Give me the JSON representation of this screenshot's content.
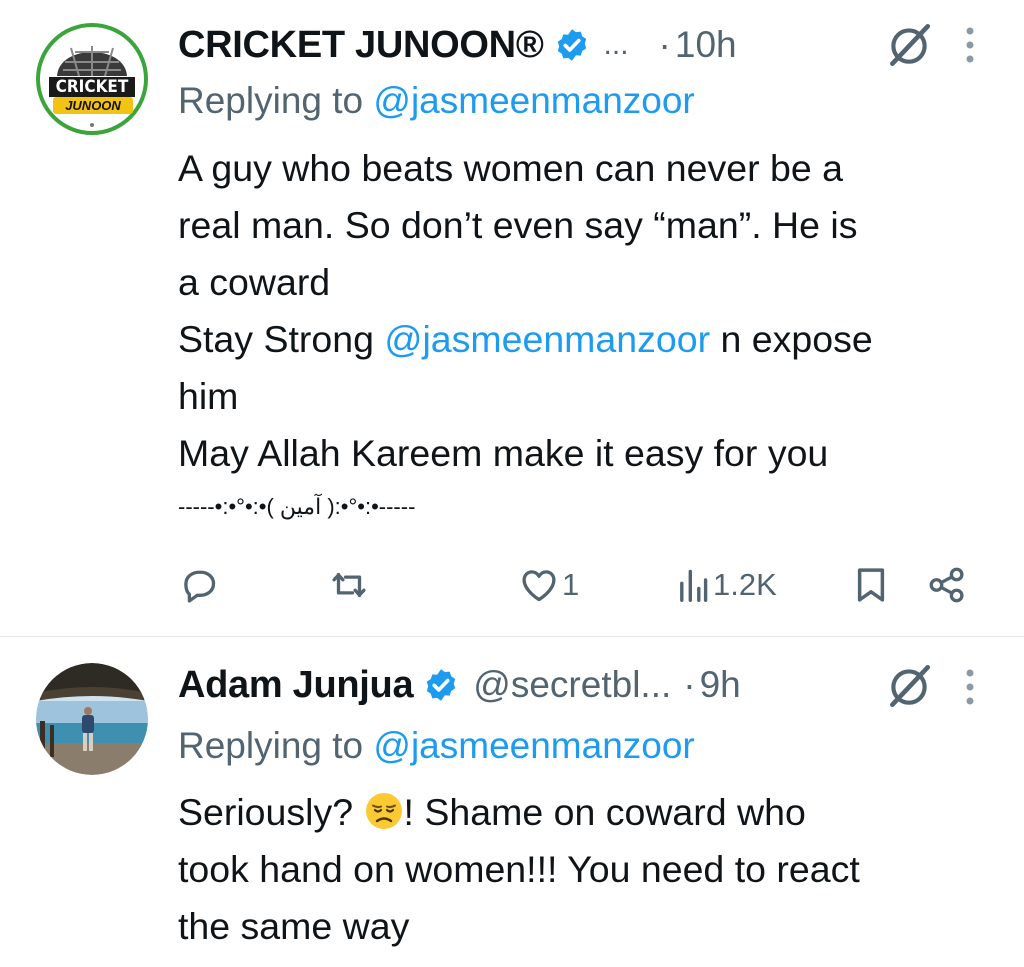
{
  "tweets": [
    {
      "author": "CRICKET JUNOON®",
      "handle": "...",
      "dot": "·",
      "time": "10h",
      "reply_prefix": "Replying to ",
      "reply_handle": "@jasmeenmanzoor",
      "avatar_text_top": "CRICKET",
      "avatar_text_bottom": "JUNOON",
      "lines": {
        "l1": "A guy who beats women can never be a",
        "l2": "real man. So don’t even say “man”. He is",
        "l3": "a coward",
        "l4a": "Stay Strong ",
        "l4b": "@jasmeenmanzoor",
        "l4c": " n expose",
        "l5": "him",
        "l6": "May Allah Kareem make it easy for you",
        "l7": "-----•:•°•:•( آمين ):•°•:•-----"
      },
      "actions": {
        "replies": "",
        "retweets": "",
        "likes": "1",
        "views": "1.2K"
      }
    },
    {
      "author": "Adam Junjua",
      "handle": "@secretbl...",
      "dot": "·",
      "time": "9h",
      "reply_prefix": "Replying to ",
      "reply_handle": "@jasmeenmanzoor",
      "lines": {
        "l1a": "Seriously? ",
        "l1b": "! Shame on coward who",
        "l2": "took hand on women!!! You need to react",
        "l3": "the same way"
      }
    }
  ],
  "icons": [
    "verified-badge-icon",
    "grok-icon",
    "more-icon",
    "reply-icon",
    "retweet-icon",
    "like-icon",
    "views-icon",
    "bookmark-icon",
    "share-icon",
    "disappointed-emoji-icon"
  ],
  "colors": {
    "link": "#1d9bf0",
    "muted": "#536471",
    "text": "#0f1419",
    "badge": "#1d9bf0"
  }
}
